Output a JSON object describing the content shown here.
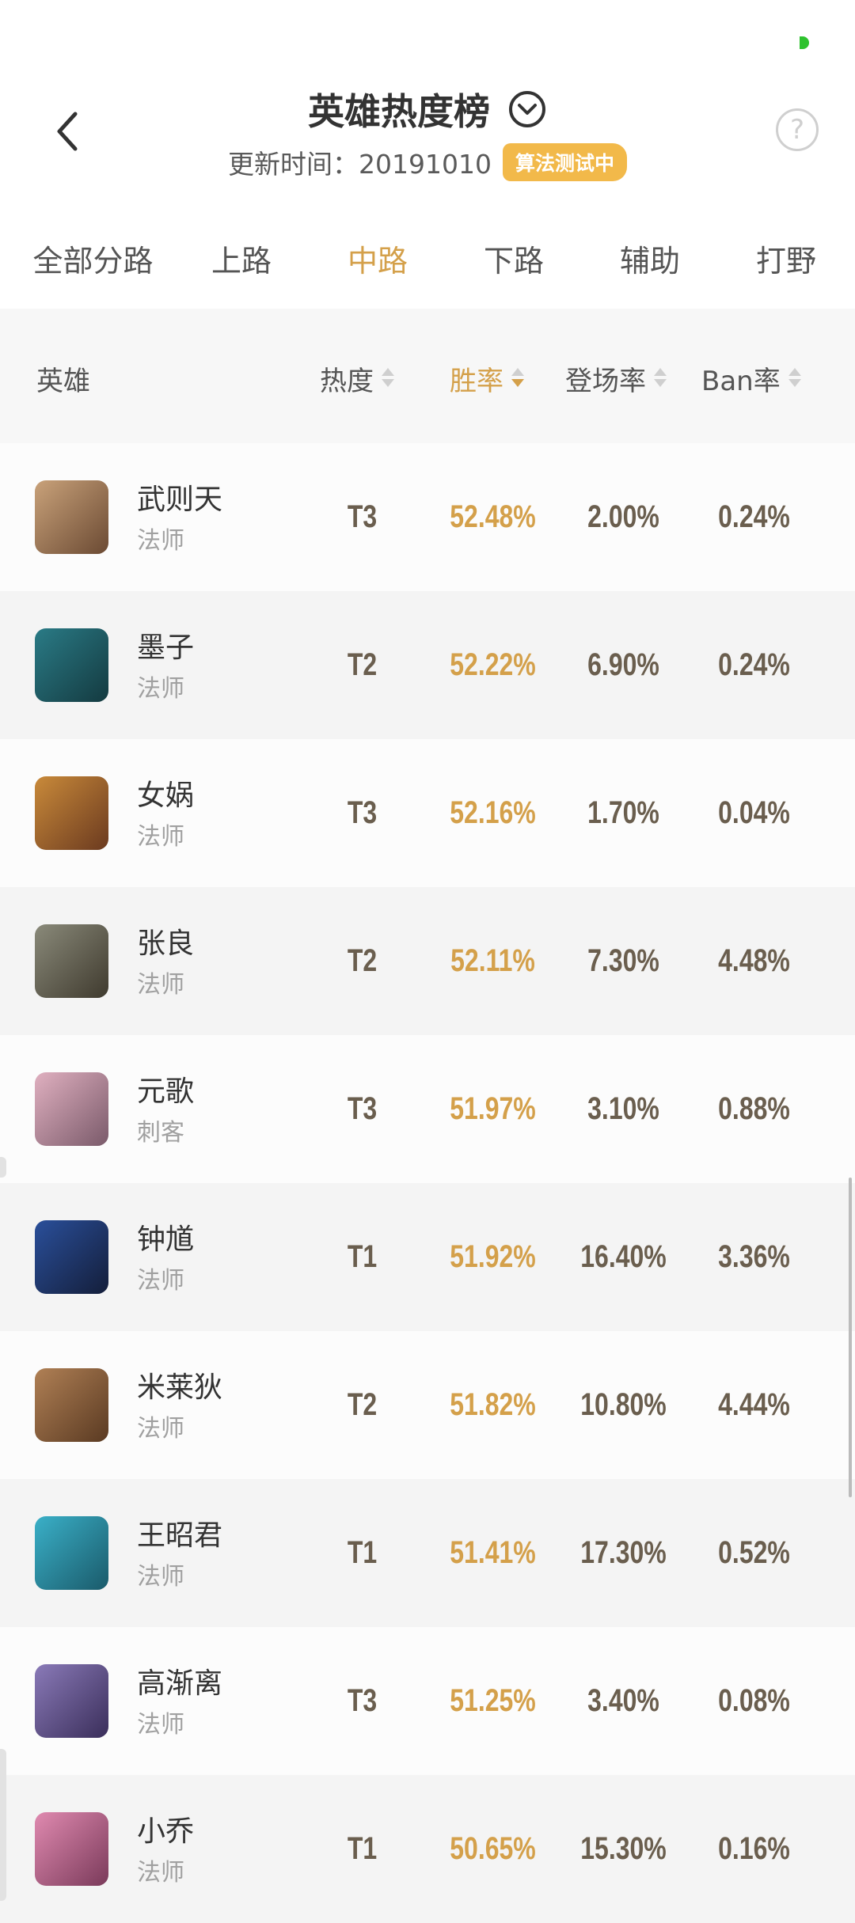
{
  "header": {
    "title": "英雄热度榜",
    "update_label": "更新时间：20191010",
    "badge": "算法测试中",
    "help_glyph": "?"
  },
  "tabs": [
    {
      "label": "全部分路",
      "active": false
    },
    {
      "label": "上路",
      "active": false
    },
    {
      "label": "中路",
      "active": true
    },
    {
      "label": "下路",
      "active": false
    },
    {
      "label": "辅助",
      "active": false
    },
    {
      "label": "打野",
      "active": false
    }
  ],
  "columns": {
    "hero": "英雄",
    "heat": "热度",
    "win_rate": "胜率",
    "pick_rate": "登场率",
    "ban_rate": "Ban率"
  },
  "sort_active": "win_rate",
  "rows": [
    {
      "name": "武则天",
      "role": "法师",
      "tier": "T3",
      "win": "52.48%",
      "pick": "2.00%",
      "ban": "0.24%"
    },
    {
      "name": "墨子",
      "role": "法师",
      "tier": "T2",
      "win": "52.22%",
      "pick": "6.90%",
      "ban": "0.24%"
    },
    {
      "name": "女娲",
      "role": "法师",
      "tier": "T3",
      "win": "52.16%",
      "pick": "1.70%",
      "ban": "0.04%"
    },
    {
      "name": "张良",
      "role": "法师",
      "tier": "T2",
      "win": "52.11%",
      "pick": "7.30%",
      "ban": "4.48%"
    },
    {
      "name": "元歌",
      "role": "刺客",
      "tier": "T3",
      "win": "51.97%",
      "pick": "3.10%",
      "ban": "0.88%"
    },
    {
      "name": "钟馗",
      "role": "法师",
      "tier": "T1",
      "win": "51.92%",
      "pick": "16.40%",
      "ban": "3.36%"
    },
    {
      "name": "米莱狄",
      "role": "法师",
      "tier": "T2",
      "win": "51.82%",
      "pick": "10.80%",
      "ban": "4.44%"
    },
    {
      "name": "王昭君",
      "role": "法师",
      "tier": "T1",
      "win": "51.41%",
      "pick": "17.30%",
      "ban": "0.52%"
    },
    {
      "name": "高渐离",
      "role": "法师",
      "tier": "T3",
      "win": "51.25%",
      "pick": "3.40%",
      "ban": "0.08%"
    },
    {
      "name": "小乔",
      "role": "法师",
      "tier": "T1",
      "win": "50.65%",
      "pick": "15.30%",
      "ban": "0.16%"
    }
  ],
  "colors": {
    "accent": "#d4a04a",
    "badge_bg": "#f2b94a",
    "value_text": "#6a5e4e"
  }
}
